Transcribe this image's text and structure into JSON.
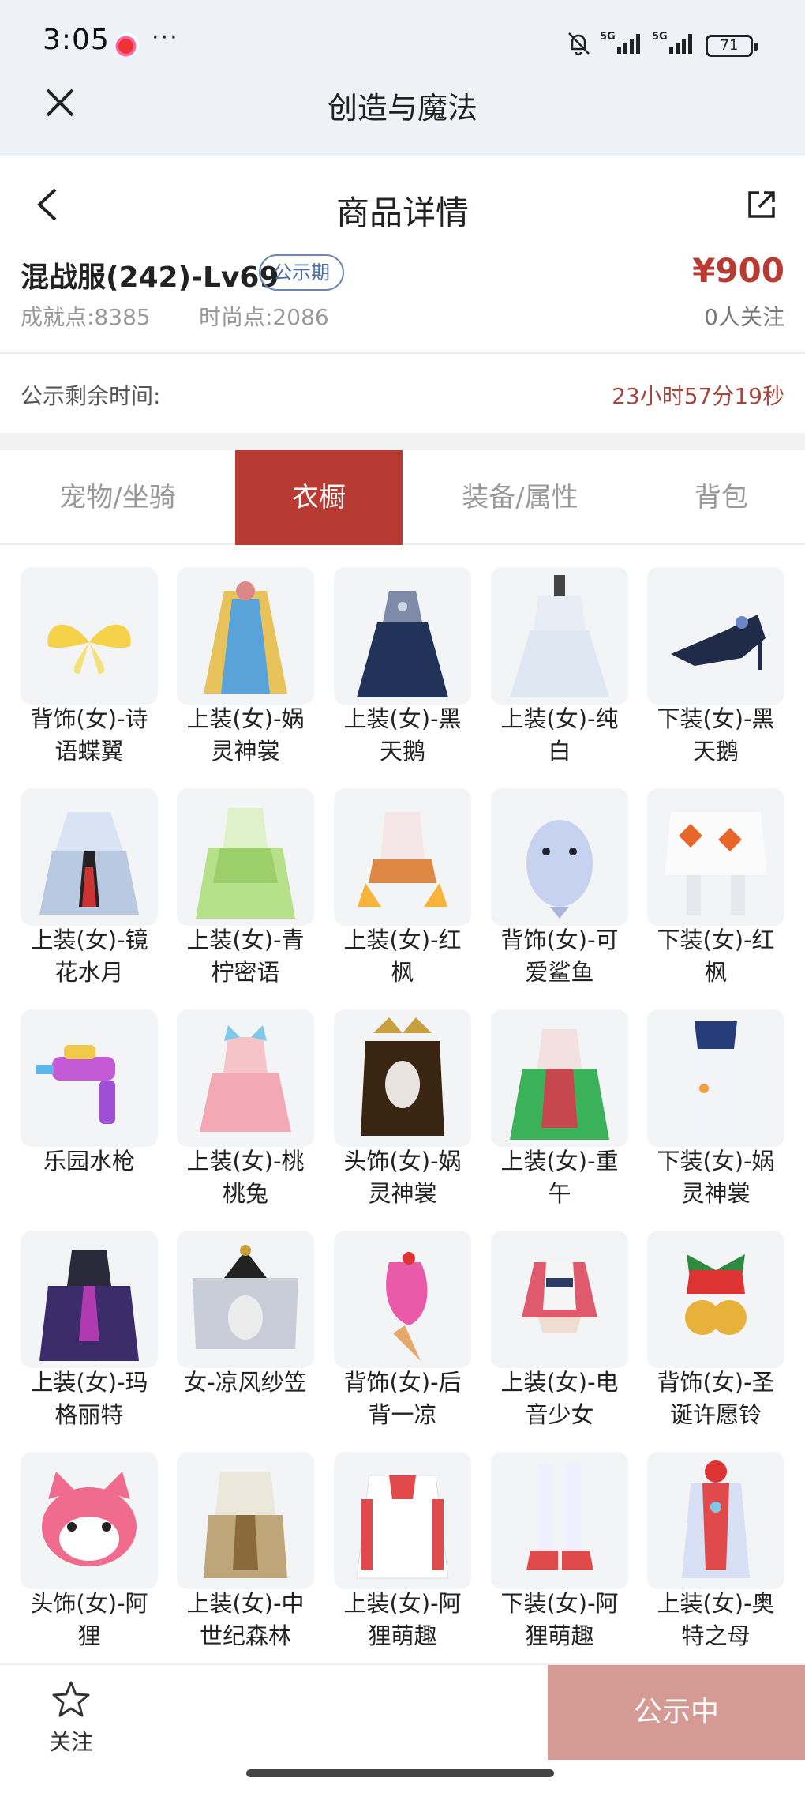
{
  "status_bar": {
    "time": "3:05",
    "dots": "···",
    "battery": "71",
    "network": "5G",
    "icons": [
      "weibo-icon",
      "more-dots-icon",
      "silent-bell-icon",
      "signal-5g-icon",
      "signal-5g-icon",
      "battery-icon"
    ]
  },
  "app_header": {
    "title": "创造与魔法",
    "close_icon": "close-icon"
  },
  "page_header": {
    "title": "商品详情",
    "back_icon": "chevron-left-icon",
    "share_icon": "share-icon"
  },
  "product": {
    "name": "混战服(242)-Lv69",
    "badge": "公示期",
    "achievement": "成就点:8385",
    "fashion": "时尚点:2086",
    "price": "¥900",
    "followers": "0人关注"
  },
  "countdown": {
    "label": "公示剩余时间:",
    "value": "23小时57分19秒"
  },
  "tabs": [
    {
      "label": "宠物/坐骑",
      "active": false
    },
    {
      "label": "衣橱",
      "active": true
    },
    {
      "label": "装备/属性",
      "active": false
    },
    {
      "label": "背包",
      "active": false
    }
  ],
  "items": [
    {
      "line1": "背饰(女)-诗",
      "line2": "语蝶翼",
      "icon": "butterfly-wings"
    },
    {
      "line1": "上装(女)-娲",
      "line2": "灵神裳",
      "icon": "goddess-robe"
    },
    {
      "line1": "上装(女)-黑",
      "line2": "天鹅",
      "icon": "black-swan-dress"
    },
    {
      "line1": "上装(女)-纯",
      "line2": "白",
      "icon": "white-dress"
    },
    {
      "line1": "下装(女)-黑",
      "line2": "天鹅",
      "icon": "black-heels"
    },
    {
      "line1": "上装(女)-镜",
      "line2": "花水月",
      "icon": "mirror-flower-robe"
    },
    {
      "line1": "上装(女)-青",
      "line2": "柠密语",
      "icon": "lime-dress"
    },
    {
      "line1": "上装(女)-红",
      "line2": "枫",
      "icon": "red-maple-top"
    },
    {
      "line1": "背饰(女)-可",
      "line2": "爱鲨鱼",
      "icon": "shark-backpack"
    },
    {
      "line1": "下装(女)-红",
      "line2": "枫",
      "icon": "maple-skirt"
    },
    {
      "line1": "乐园水枪",
      "line2": "",
      "icon": "water-gun"
    },
    {
      "line1": "上装(女)-桃",
      "line2": "桃兔",
      "icon": "pink-bunny-dress"
    },
    {
      "line1": "头饰(女)-娲",
      "line2": "灵神裳",
      "icon": "goddess-headdress"
    },
    {
      "line1": "上装(女)-重",
      "line2": "午",
      "icon": "green-festival-dress"
    },
    {
      "line1": "下装(女)-娲",
      "line2": "灵神裳",
      "icon": "goddess-leggings"
    },
    {
      "line1": "上装(女)-玛",
      "line2": "格丽特",
      "icon": "purple-gown"
    },
    {
      "line1": "女-凉风纱笠",
      "line2": "",
      "icon": "veil-hat"
    },
    {
      "line1": "背饰(女)-后",
      "line2": "背一凉",
      "icon": "ice-cream-back"
    },
    {
      "line1": "上装(女)-电",
      "line2": "音少女",
      "icon": "electro-jacket"
    },
    {
      "line1": "背饰(女)-圣",
      "line2": "诞许愿铃",
      "icon": "christmas-bells"
    },
    {
      "line1": "头饰(女)-阿",
      "line2": "狸",
      "icon": "ali-fox-head"
    },
    {
      "line1": "上装(女)-中",
      "line2": "世纪森林",
      "icon": "medieval-forest-top"
    },
    {
      "line1": "上装(女)-阿",
      "line2": "狸萌趣",
      "icon": "ali-hoodie"
    },
    {
      "line1": "下装(女)-阿",
      "line2": "狸萌趣",
      "icon": "ali-boots"
    },
    {
      "line1": "上装(女)-奥",
      "line2": "特之母",
      "icon": "ultra-mother-suit"
    }
  ],
  "bottom_bar": {
    "favorite_label": "关注",
    "favorite_icon": "star-icon",
    "status_button": "公示中"
  },
  "colors": {
    "accent": "#b73b32",
    "badge": "#4c6ea6",
    "status_button": "#d69a95",
    "header_bg": "#eef2f7"
  }
}
